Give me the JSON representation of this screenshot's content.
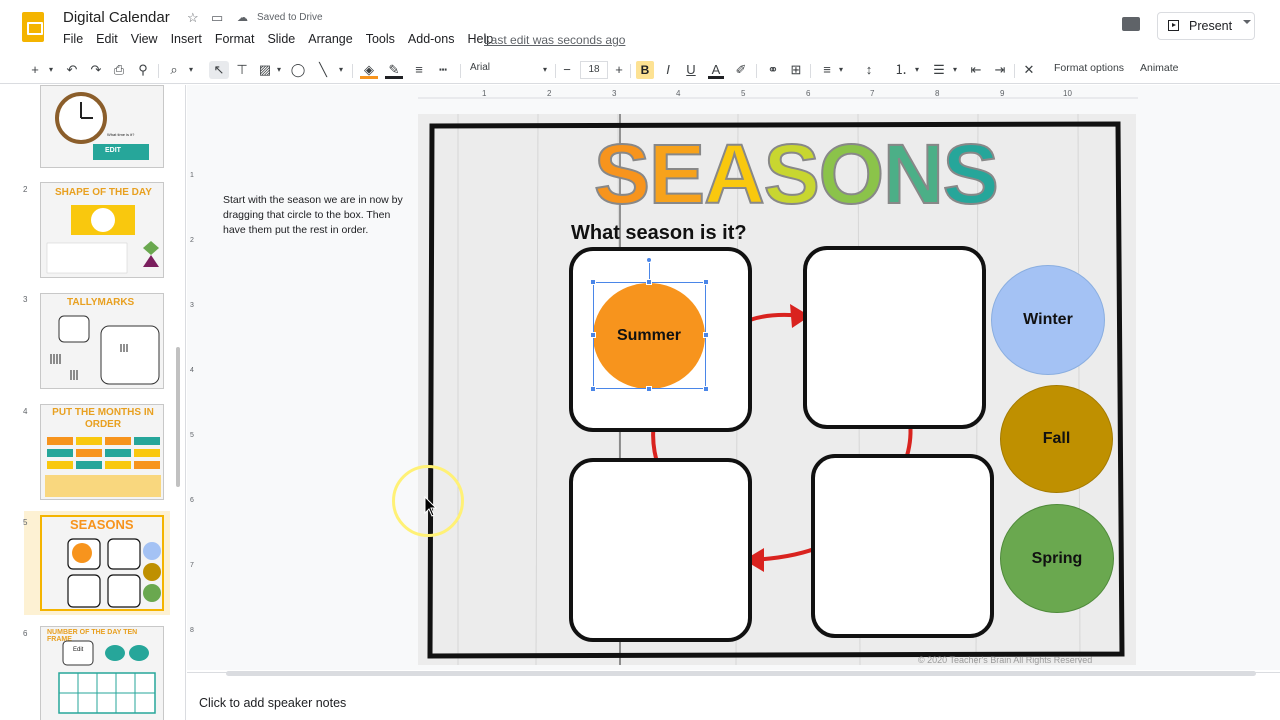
{
  "app": {
    "doc_title": "Digital Calendar",
    "saved_status": "Saved to Drive",
    "last_edit": "Last edit was seconds ago",
    "present_label": "Present"
  },
  "menu": [
    "File",
    "Edit",
    "View",
    "Insert",
    "Format",
    "Slide",
    "Arrange",
    "Tools",
    "Add-ons",
    "Help"
  ],
  "toolbar": {
    "font": "Arial",
    "font_size": "18",
    "format_options": "Format options",
    "animate": "Animate"
  },
  "filmstrip": {
    "slides": [
      {
        "num": "",
        "title": "What time is it?",
        "edit_label": "EDIT"
      },
      {
        "num": "2",
        "title": "SHAPE OF THE DAY"
      },
      {
        "num": "3",
        "title": "TALLYMARKS"
      },
      {
        "num": "4",
        "title": "PUT THE MONTHS IN ORDER"
      },
      {
        "num": "5",
        "title": "SEASONS",
        "subtitle": "What season is it?"
      },
      {
        "num": "6",
        "title": "NUMBER OF THE DAY TEN FRAME",
        "edit_label": "Edit"
      }
    ],
    "selected": 4
  },
  "slide": {
    "title": "SEASONS",
    "title_letters": [
      "S",
      "E",
      "A",
      "S",
      "O",
      "N",
      "S"
    ],
    "question": "What season is it?",
    "circles": [
      {
        "label": "Summer",
        "color": "#f7941d"
      },
      {
        "label": "Winter",
        "color": "#a4c2f4"
      },
      {
        "label": "Fall",
        "color": "#bf9000"
      },
      {
        "label": "Spring",
        "color": "#6aa84f"
      }
    ],
    "copyright": "© 2020 Teacher's Brain All Rights Reserved"
  },
  "sidenote": "Start with the season we are in now by dragging that circle to the box. Then have them put the rest in order.",
  "speaker_notes": "Click to add speaker notes",
  "ruler": {
    "h_marks": [
      "1",
      "2",
      "3",
      "4",
      "5",
      "6",
      "7",
      "8",
      "9",
      "10"
    ],
    "v_marks": [
      "1",
      "2",
      "3",
      "4",
      "5",
      "6",
      "7",
      "8"
    ]
  },
  "colors": {
    "accent": "#f4b400",
    "arrow": "#d9231f",
    "selection": "#4a86e8",
    "title_gradient": [
      "#f7941d",
      "#f9c80e",
      "#8bc34a",
      "#26a69a"
    ]
  }
}
